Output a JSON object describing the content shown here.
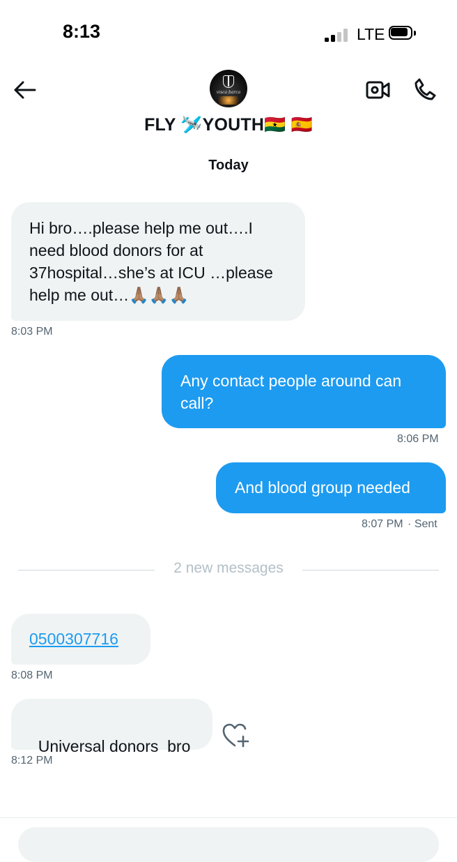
{
  "status_bar": {
    "time": "8:13",
    "network": "LTE"
  },
  "header": {
    "avatar_text": "visca barca",
    "contact_name": "FLY 🛩️YOUTH🇬🇭 🇪🇸",
    "back_icon": "arrow-left-icon",
    "video_icon": "video-call-icon",
    "call_icon": "phone-icon"
  },
  "conversation": {
    "date_label": "Today",
    "new_messages_label": "2 new messages",
    "messages": [
      {
        "direction": "incoming",
        "text": "Hi bro….please help me out….I need blood donors for at 37hospital…she’s at ICU …please help me out…🙏🏽🙏🏽🙏🏽",
        "time": "8:03 PM"
      },
      {
        "direction": "outgoing",
        "text": "Any contact people around can call?",
        "time": "8:06 PM"
      },
      {
        "direction": "outgoing",
        "text": "And blood group needed",
        "time": "8:07 PM",
        "status": "· Sent"
      },
      {
        "direction": "incoming",
        "text": "0500307716",
        "time": "8:08 PM"
      },
      {
        "direction": "incoming",
        "text": "Universal donors  bro",
        "time": "8:12 PM"
      }
    ]
  },
  "colors": {
    "accent": "#1d9bf0",
    "incoming_bubble": "#eff3f4",
    "secondary_text": "#536471"
  }
}
